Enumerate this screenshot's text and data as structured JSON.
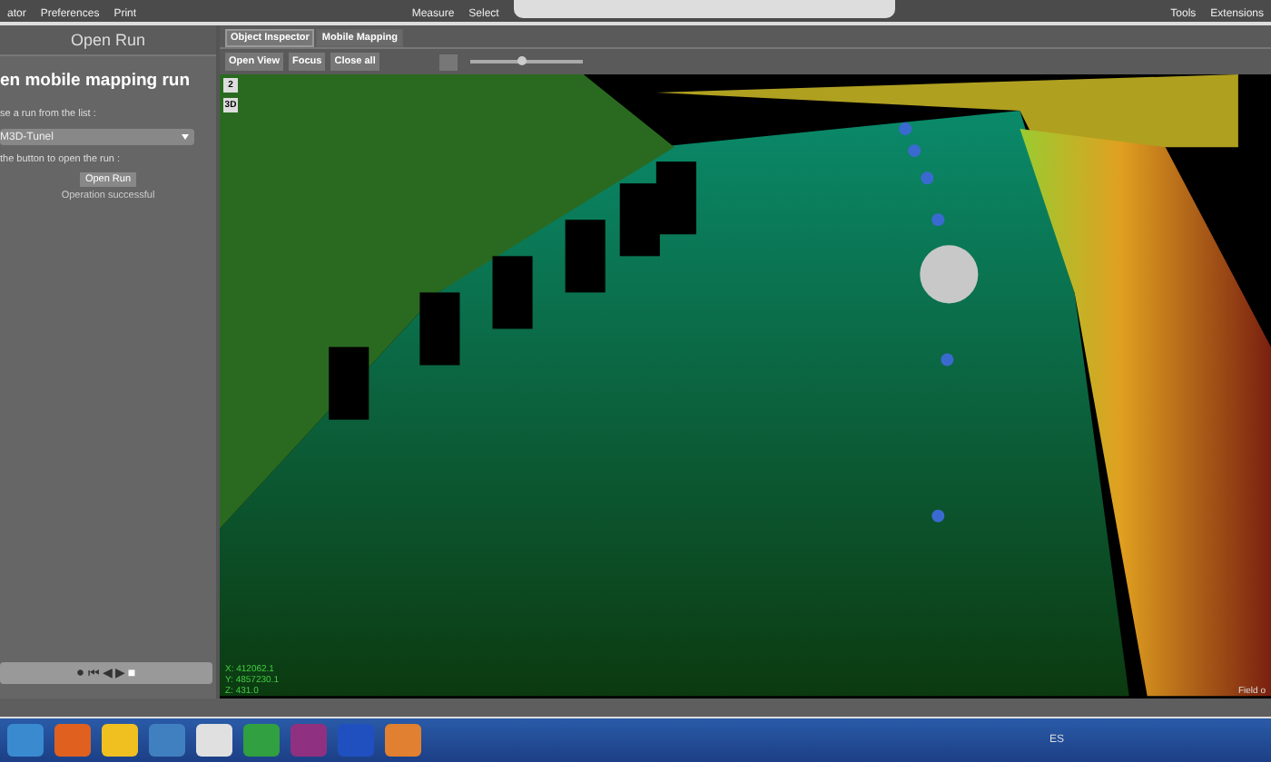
{
  "toolbar": {
    "left_items": [
      {
        "label": "ator"
      },
      {
        "label": "Preferences"
      },
      {
        "label": "Print"
      }
    ],
    "right_items": [
      {
        "label": "Measure"
      },
      {
        "label": "Select"
      }
    ],
    "search": {
      "kind": "pill"
    },
    "far_right_items": [
      {
        "label": "Tools"
      },
      {
        "label": "Extensions"
      }
    ]
  },
  "left_panel": {
    "title": "Open Run",
    "heading": "en mobile mapping run",
    "instruction": "se a run from the list :",
    "run_select": {
      "value": "M3D-Tunel"
    },
    "button_hint": "the button to open the run :",
    "open_button": "Open Run",
    "status": "Operation successful",
    "player_buttons": [
      "⏺",
      "⏮",
      "◀",
      "▶",
      "■"
    ]
  },
  "tabs": [
    {
      "label": "Object Inspector",
      "selected": true
    },
    {
      "label": "Mobile Mapping",
      "selected": false
    }
  ],
  "view_buttons": [
    "Open View",
    "Focus",
    "Close all"
  ],
  "zoom_slider": {
    "level": 0.45
  },
  "viewport": {
    "coordinates": [
      "X: 412062.1",
      "Y: 4857230.1",
      "Z: 431.0"
    ],
    "corner_label": "Field o",
    "side_tools": [
      "2",
      "3D"
    ]
  },
  "taskbar": {
    "language": "ES"
  }
}
